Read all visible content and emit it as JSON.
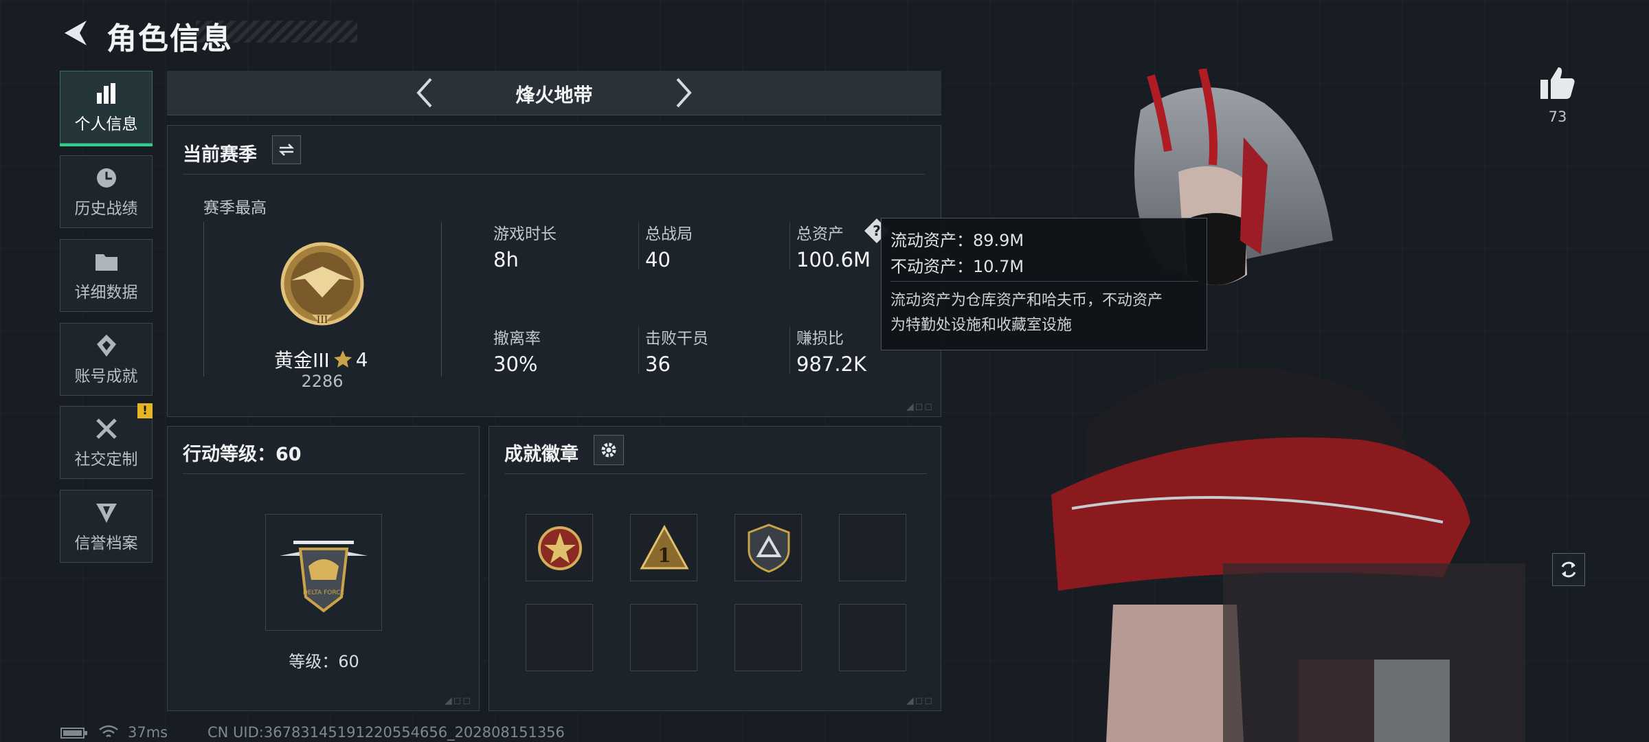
{
  "header": {
    "title": "角色信息"
  },
  "sidebar": {
    "items": [
      {
        "label": "个人信息",
        "icon": "bar-chart-icon",
        "active": true
      },
      {
        "label": "历史战绩",
        "icon": "history-icon"
      },
      {
        "label": "详细数据",
        "icon": "folder-icon"
      },
      {
        "label": "账号成就",
        "icon": "achievement-icon"
      },
      {
        "label": "社交定制",
        "icon": "tools-icon",
        "badge": "!"
      },
      {
        "label": "信誉档案",
        "icon": "reputation-icon"
      }
    ]
  },
  "mode": {
    "name": "烽火地带"
  },
  "season": {
    "title": "当前赛季",
    "best_label": "赛季最高",
    "rank_name": "黄金III",
    "rank_stars": "4",
    "rank_score": "2286",
    "stats": [
      {
        "label": "游戏时长",
        "value": "8h"
      },
      {
        "label": "总战局",
        "value": "40"
      },
      {
        "label": "总资产",
        "value": "100.6M"
      },
      {
        "label": "撤离率",
        "value": "30%"
      },
      {
        "label": "击败干员",
        "value": "36"
      },
      {
        "label": "赚损比",
        "value": "987.2K"
      }
    ]
  },
  "tooltip": {
    "line1": "流动资产：89.9M",
    "line2": "不动资产：10.7M",
    "desc1": "流动资产为仓库资产和哈夫币，不动资产",
    "desc2": "为特勤处设施和收藏室设施"
  },
  "action_level": {
    "title": "行动等级：60",
    "caption": "等级：60"
  },
  "achievements": {
    "title": "成就徽章"
  },
  "likes": {
    "count": "73"
  },
  "status": {
    "ping": "37ms",
    "uid": "CN UID:3678314519122055465​6_202808151356"
  },
  "colors": {
    "accent": "#2ed18b",
    "gold": "#c9a24a",
    "warning": "#e8b522"
  }
}
